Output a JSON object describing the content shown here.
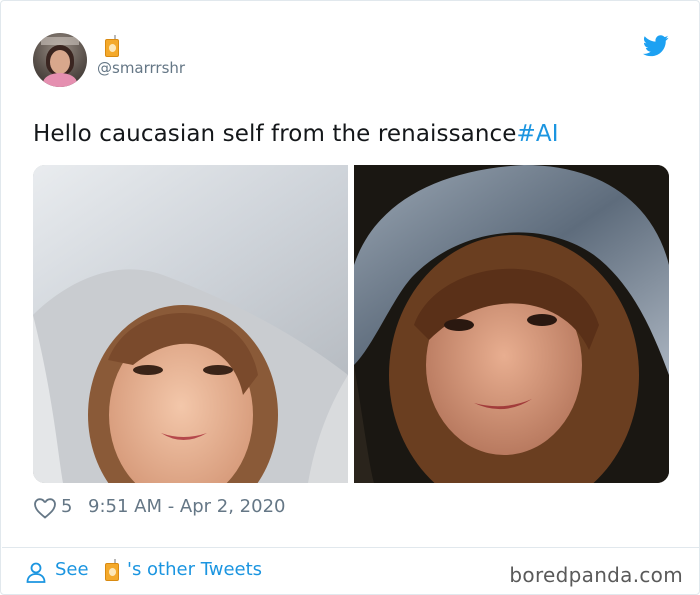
{
  "tweet": {
    "handle": "@smarrrshr",
    "text": "Hello caucasian self from the renaissance",
    "hashtag": "#AI",
    "likes": "5",
    "timestamp": "9:51 AM - Apr 2, 2020"
  },
  "footer": {
    "see_label": "See",
    "others_label": "'s other Tweets"
  },
  "watermark": "boredpanda.com",
  "icons": {
    "name_emoji": "juice-box-icon",
    "brand": "twitter-bird-icon",
    "like": "heart-icon",
    "profile": "person-icon"
  },
  "colors": {
    "link": "#1b95e0",
    "muted": "#657786",
    "text": "#14171a",
    "border": "#e1e8ed"
  }
}
